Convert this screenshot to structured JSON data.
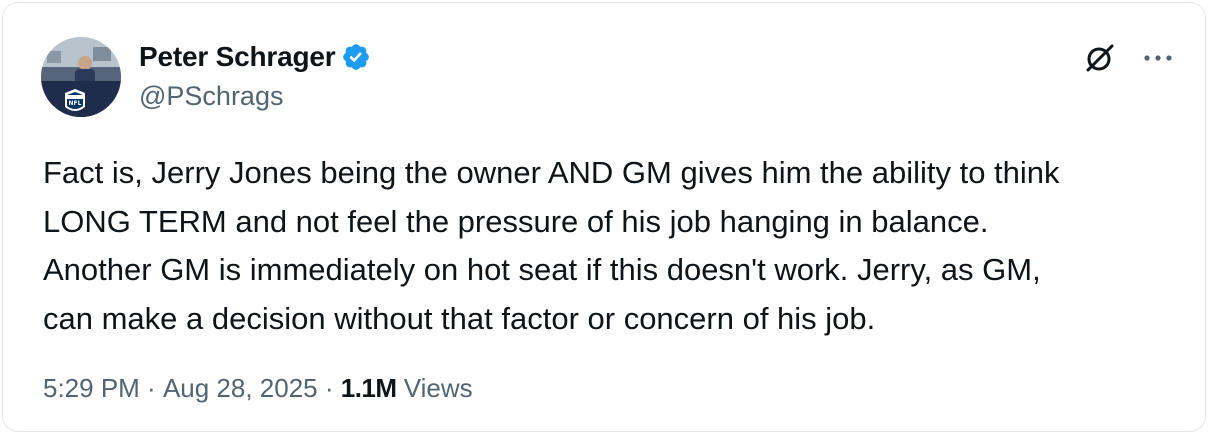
{
  "author": {
    "name": "Peter Schrager",
    "handle": "@PSchrags",
    "verified": true
  },
  "tweet": {
    "text": "Fact is, Jerry Jones being the owner AND GM gives him the ability to think\nLONG TERM and not feel the pressure of his job hanging in balance.\nAnother GM is immediately on hot seat if this doesn't work. Jerry, as GM,\ncan make a decision without that factor or concern of his job."
  },
  "meta": {
    "time": "5:29 PM",
    "separator": " · ",
    "date": "Aug 28, 2025",
    "views_count": "1.1M",
    "views_label": " Views"
  },
  "icons": {
    "verified": "verified-badge-icon",
    "grok": "grok-icon",
    "more": "more-icon"
  },
  "colors": {
    "text_primary": "#0f1419",
    "text_secondary": "#536471",
    "verified_blue": "#1d9bf0",
    "border": "#e3e7ea"
  }
}
